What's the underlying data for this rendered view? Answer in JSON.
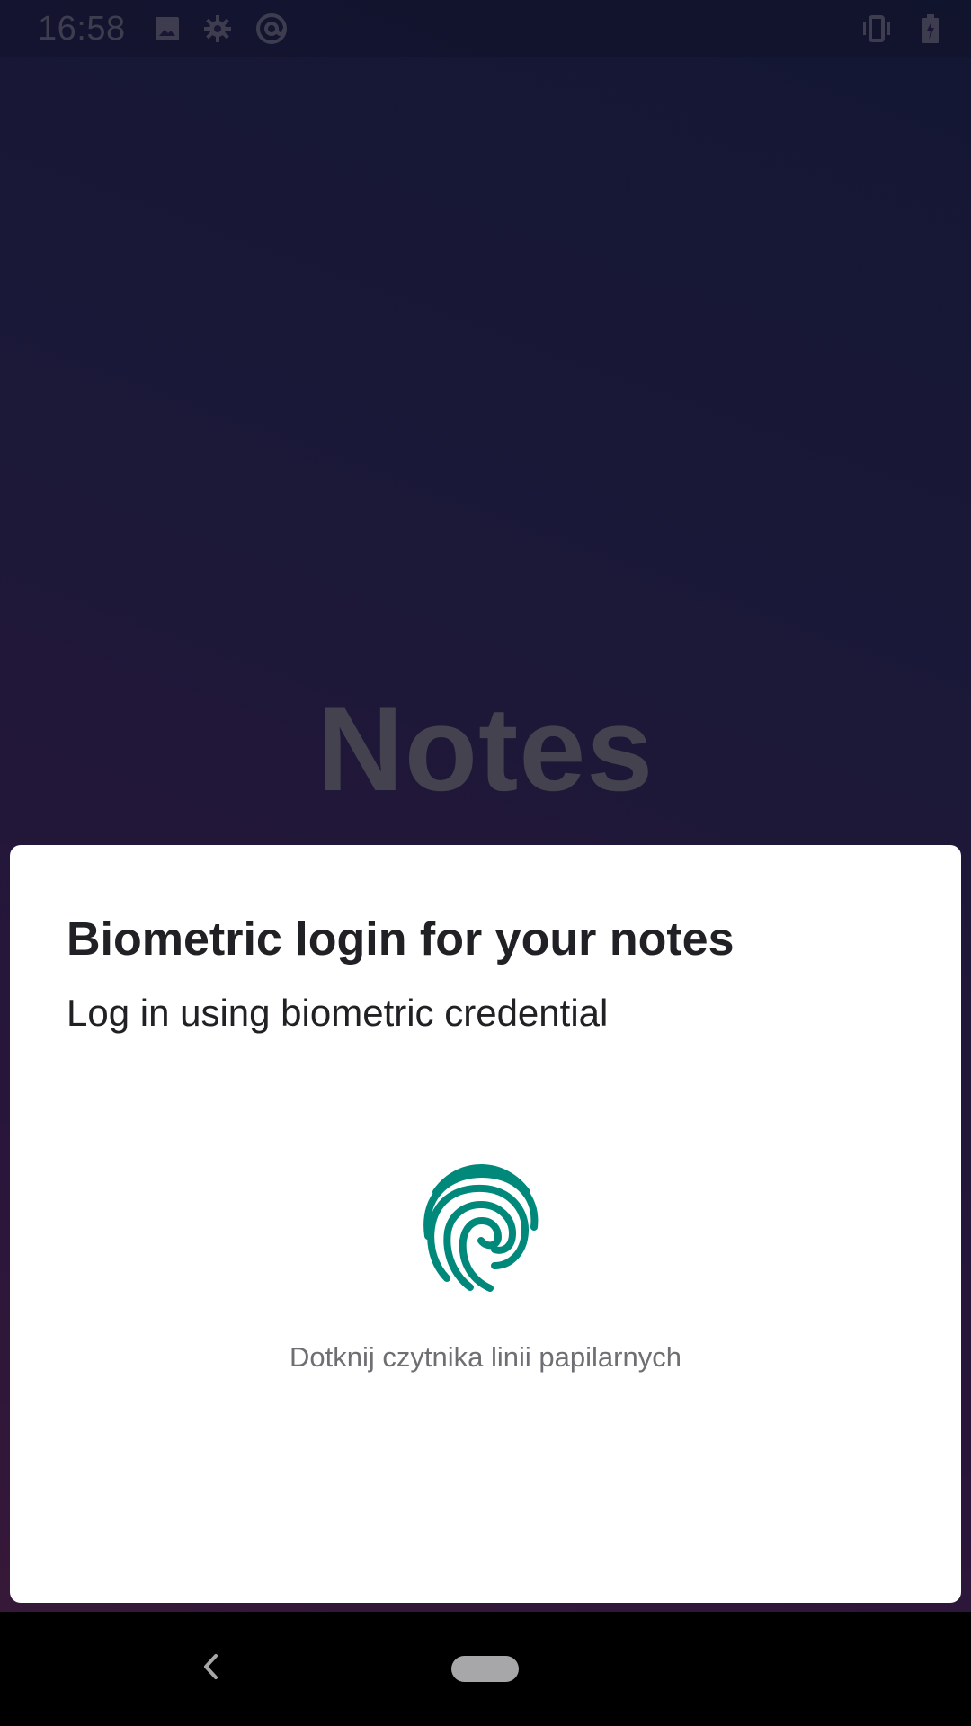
{
  "status_bar": {
    "time": "16:58",
    "icons": [
      "image-icon",
      "gear-icon",
      "at-sign-icon",
      "vibrate-icon",
      "battery-charging-icon"
    ]
  },
  "app": {
    "title": "Notes"
  },
  "biometric_prompt": {
    "title": "Biometric login for your notes",
    "subtitle": "Log in using biometric credential",
    "hint": "Dotknij czytnika linii papilarnych",
    "icon": "fingerprint-icon",
    "accent_color": "#00897b"
  },
  "navigation": {
    "back_icon": "back-icon",
    "home_icon": "home-pill-icon"
  }
}
